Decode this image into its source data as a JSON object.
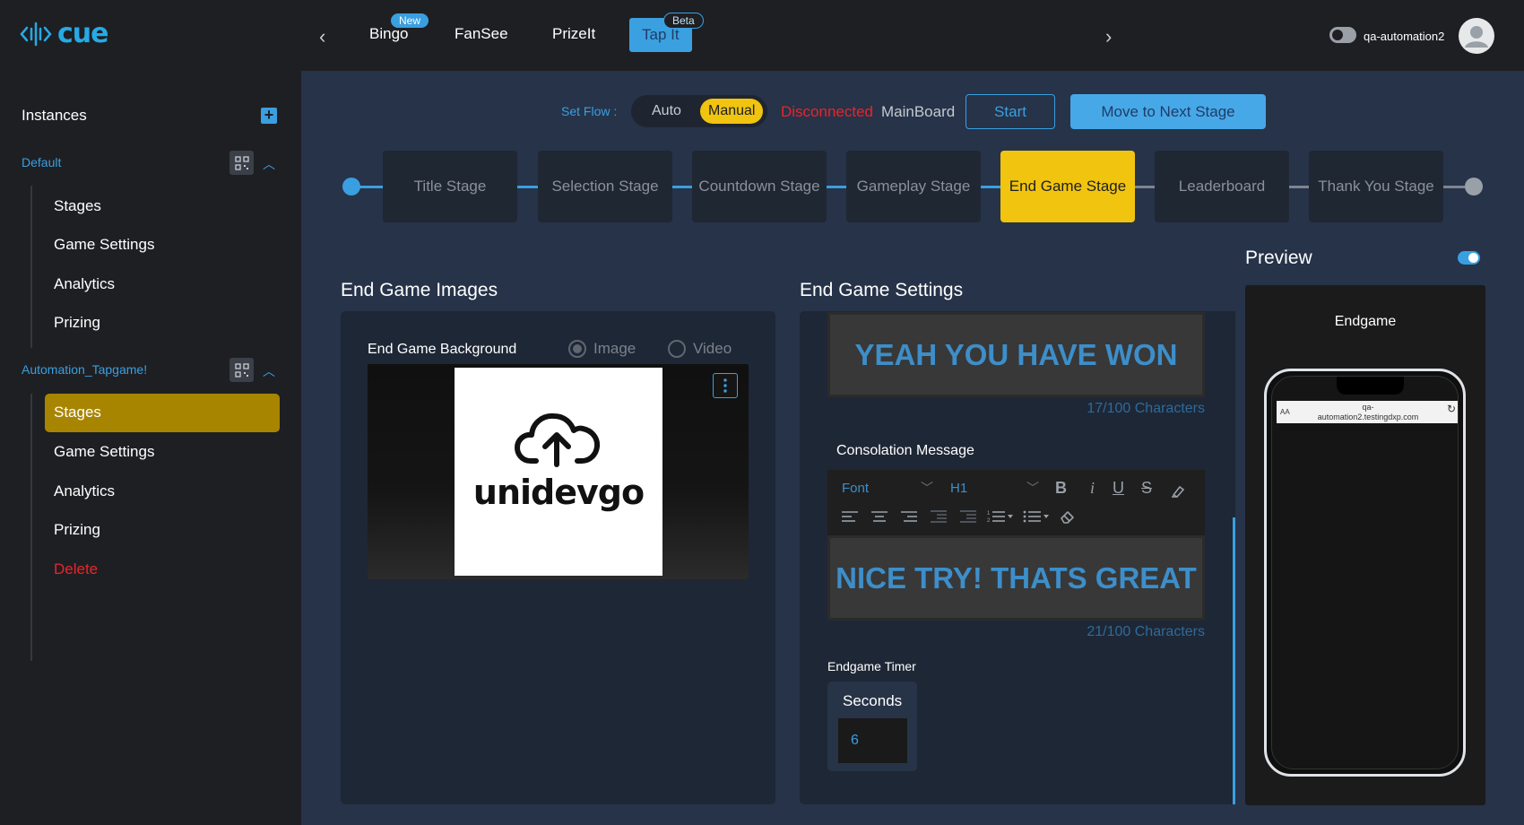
{
  "brand": {
    "name": "cue",
    "accent": "#27a9e6",
    "highlight": "#f1c40f"
  },
  "topnav": {
    "tabs": [
      {
        "label": "Bingo",
        "badge": "New"
      },
      {
        "label": "FanSee"
      },
      {
        "label": "PrizeIt"
      },
      {
        "label": "Tap It",
        "badge": "Beta",
        "active": true
      }
    ],
    "username": "qa-automation2"
  },
  "sidebar": {
    "title": "Instances",
    "groups": [
      {
        "name": "Default",
        "items": [
          "Stages",
          "Game Settings",
          "Analytics",
          "Prizing"
        ]
      },
      {
        "name": "Automation_Tapgame!",
        "items": [
          "Stages",
          "Game Settings",
          "Analytics",
          "Prizing",
          "Delete"
        ],
        "active_item": "Stages"
      }
    ]
  },
  "flow": {
    "label": "Set Flow :",
    "options": [
      "Auto",
      "Manual"
    ],
    "selected": "Manual",
    "status": "Disconnected",
    "board": "MainBoard",
    "start_label": "Start",
    "next_label": "Move to Next Stage"
  },
  "stages": [
    "Title Stage",
    "Selection Stage",
    "Countdown Stage",
    "Gameplay Stage",
    "End Game Stage",
    "Leaderboard",
    "Thank You Stage"
  ],
  "active_stage": "End Game Stage",
  "images": {
    "title": "End Game Images",
    "field_label": "End Game Background",
    "media_options": [
      "Image",
      "Video"
    ],
    "media_selected": "Image",
    "uploaded_brand": "unidevgo"
  },
  "settings": {
    "title": "End Game Settings",
    "win_message": "YEAH YOU HAVE WON",
    "win_count": "17/100 Characters",
    "consolation_label": "Consolation Message",
    "font_placeholder": "Font",
    "heading_value": "H1",
    "consolation_message": "NICE TRY! THATS GREAT",
    "consolation_count": "21/100 Characters",
    "timer_label": "Endgame Timer",
    "seconds_label": "Seconds",
    "seconds_value": "6"
  },
  "preview": {
    "title": "Preview",
    "screen_name": "Endgame",
    "url_line1": "qa-",
    "url_line2": "automation2.testingdxp.com",
    "aa_label": "AA"
  }
}
